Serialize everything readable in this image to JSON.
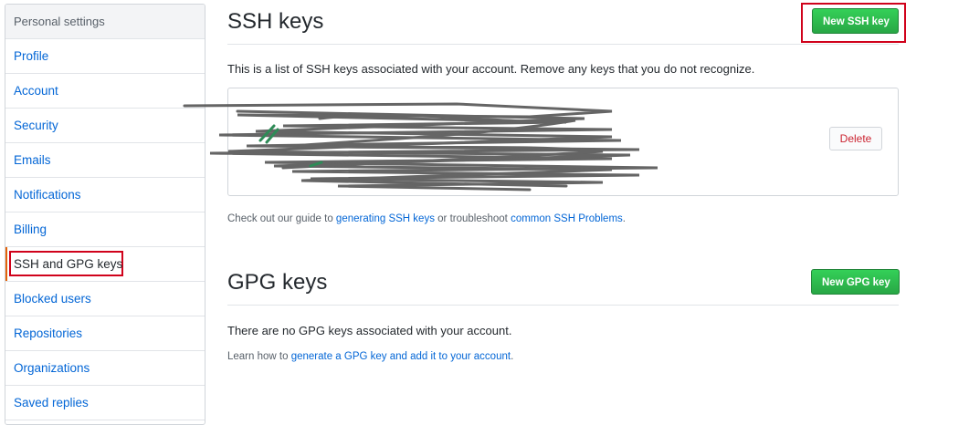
{
  "sidebar": {
    "header": "Personal settings",
    "items": [
      {
        "label": "Profile"
      },
      {
        "label": "Account"
      },
      {
        "label": "Security"
      },
      {
        "label": "Emails"
      },
      {
        "label": "Notifications"
      },
      {
        "label": "Billing"
      },
      {
        "label": "SSH and GPG keys",
        "selected": true
      },
      {
        "label": "Blocked users"
      },
      {
        "label": "Repositories"
      },
      {
        "label": "Organizations"
      },
      {
        "label": "Saved replies"
      }
    ]
  },
  "ssh": {
    "title": "SSH keys",
    "new_button": "New SSH key",
    "description": "This is a list of SSH keys associated with your account. Remove any keys that you do not recognize.",
    "delete_button": "Delete",
    "guide_prefix": "Check out our guide to ",
    "guide_link": "generating SSH keys",
    "guide_middle": " or troubleshoot ",
    "guide_link2": "common SSH Problems",
    "guide_suffix": "."
  },
  "gpg": {
    "title": "GPG keys",
    "new_button": "New GPG key",
    "empty_message": "There are no GPG keys associated with your account.",
    "learn_prefix": "Learn how to ",
    "learn_link": "generate a GPG key and add it to your account",
    "learn_suffix": "."
  },
  "colors": {
    "link": "#0366d6",
    "green_button": "#28a745",
    "annotation_red": "#d0021b",
    "danger": "#cb2431"
  }
}
